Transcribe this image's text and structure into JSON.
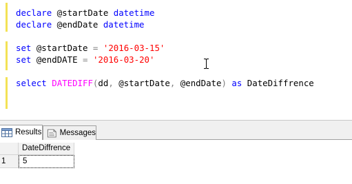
{
  "editor": {
    "lines": [
      [
        {
          "t": "declare",
          "c": "kw"
        },
        {
          "t": " @startDate ",
          "c": "id"
        },
        {
          "t": "datetime",
          "c": "kw"
        }
      ],
      [
        {
          "t": "declare",
          "c": "kw"
        },
        {
          "t": " @endDate ",
          "c": "id"
        },
        {
          "t": "datetime",
          "c": "kw"
        }
      ],
      [
        {
          "t": "set",
          "c": "kw"
        },
        {
          "t": " @startDate ",
          "c": "id"
        },
        {
          "t": "=",
          "c": "pun"
        },
        {
          "t": " ",
          "c": "id"
        },
        {
          "t": "'2016-03-15'",
          "c": "str"
        }
      ],
      [
        {
          "t": "set",
          "c": "kw"
        },
        {
          "t": " @endDATE ",
          "c": "id"
        },
        {
          "t": "=",
          "c": "pun"
        },
        {
          "t": " ",
          "c": "id"
        },
        {
          "t": "'2016-03-20'",
          "c": "str"
        }
      ],
      [
        {
          "t": "select",
          "c": "kw"
        },
        {
          "t": " ",
          "c": "id"
        },
        {
          "t": "DATEDIFF",
          "c": "fn"
        },
        {
          "t": "(",
          "c": "pun"
        },
        {
          "t": "dd",
          "c": "id"
        },
        {
          "t": ",",
          "c": "pun"
        },
        {
          "t": " @startDate",
          "c": "id"
        },
        {
          "t": ",",
          "c": "pun"
        },
        {
          "t": " @endDate",
          "c": "id"
        },
        {
          "t": ")",
          "c": "pun"
        },
        {
          "t": " ",
          "c": "id"
        },
        {
          "t": "as",
          "c": "kw"
        },
        {
          "t": " DateDiffrence",
          "c": "id"
        }
      ]
    ]
  },
  "tabs": {
    "results": "Results",
    "messages": "Messages"
  },
  "grid": {
    "column": "DateDiffrence",
    "row_number": "1",
    "value": "5"
  },
  "colors": {
    "keyword": "#0000ff",
    "function": "#ff00ff",
    "string": "#ff0000",
    "operator": "#808080",
    "block_marker": "#f3e255"
  }
}
